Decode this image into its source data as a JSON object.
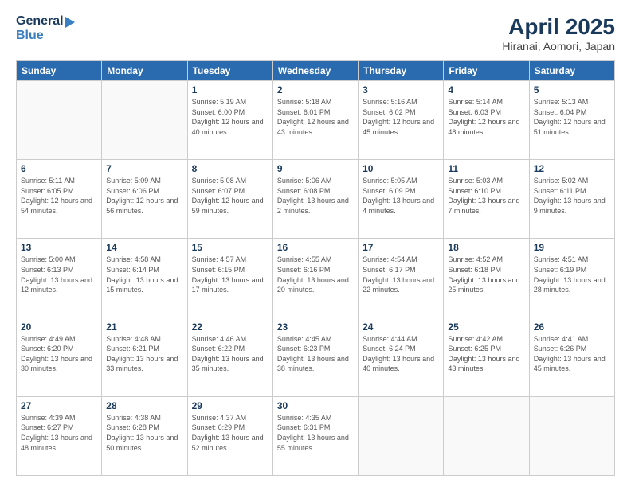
{
  "header": {
    "logo_general": "General",
    "logo_blue": "Blue",
    "title": "April 2025",
    "subtitle": "Hiranai, Aomori, Japan"
  },
  "days_of_week": [
    "Sunday",
    "Monday",
    "Tuesday",
    "Wednesday",
    "Thursday",
    "Friday",
    "Saturday"
  ],
  "weeks": [
    [
      {
        "day": "",
        "info": ""
      },
      {
        "day": "",
        "info": ""
      },
      {
        "day": "1",
        "info": "Sunrise: 5:19 AM\nSunset: 6:00 PM\nDaylight: 12 hours and 40 minutes."
      },
      {
        "day": "2",
        "info": "Sunrise: 5:18 AM\nSunset: 6:01 PM\nDaylight: 12 hours and 43 minutes."
      },
      {
        "day": "3",
        "info": "Sunrise: 5:16 AM\nSunset: 6:02 PM\nDaylight: 12 hours and 45 minutes."
      },
      {
        "day": "4",
        "info": "Sunrise: 5:14 AM\nSunset: 6:03 PM\nDaylight: 12 hours and 48 minutes."
      },
      {
        "day": "5",
        "info": "Sunrise: 5:13 AM\nSunset: 6:04 PM\nDaylight: 12 hours and 51 minutes."
      }
    ],
    [
      {
        "day": "6",
        "info": "Sunrise: 5:11 AM\nSunset: 6:05 PM\nDaylight: 12 hours and 54 minutes."
      },
      {
        "day": "7",
        "info": "Sunrise: 5:09 AM\nSunset: 6:06 PM\nDaylight: 12 hours and 56 minutes."
      },
      {
        "day": "8",
        "info": "Sunrise: 5:08 AM\nSunset: 6:07 PM\nDaylight: 12 hours and 59 minutes."
      },
      {
        "day": "9",
        "info": "Sunrise: 5:06 AM\nSunset: 6:08 PM\nDaylight: 13 hours and 2 minutes."
      },
      {
        "day": "10",
        "info": "Sunrise: 5:05 AM\nSunset: 6:09 PM\nDaylight: 13 hours and 4 minutes."
      },
      {
        "day": "11",
        "info": "Sunrise: 5:03 AM\nSunset: 6:10 PM\nDaylight: 13 hours and 7 minutes."
      },
      {
        "day": "12",
        "info": "Sunrise: 5:02 AM\nSunset: 6:11 PM\nDaylight: 13 hours and 9 minutes."
      }
    ],
    [
      {
        "day": "13",
        "info": "Sunrise: 5:00 AM\nSunset: 6:13 PM\nDaylight: 13 hours and 12 minutes."
      },
      {
        "day": "14",
        "info": "Sunrise: 4:58 AM\nSunset: 6:14 PM\nDaylight: 13 hours and 15 minutes."
      },
      {
        "day": "15",
        "info": "Sunrise: 4:57 AM\nSunset: 6:15 PM\nDaylight: 13 hours and 17 minutes."
      },
      {
        "day": "16",
        "info": "Sunrise: 4:55 AM\nSunset: 6:16 PM\nDaylight: 13 hours and 20 minutes."
      },
      {
        "day": "17",
        "info": "Sunrise: 4:54 AM\nSunset: 6:17 PM\nDaylight: 13 hours and 22 minutes."
      },
      {
        "day": "18",
        "info": "Sunrise: 4:52 AM\nSunset: 6:18 PM\nDaylight: 13 hours and 25 minutes."
      },
      {
        "day": "19",
        "info": "Sunrise: 4:51 AM\nSunset: 6:19 PM\nDaylight: 13 hours and 28 minutes."
      }
    ],
    [
      {
        "day": "20",
        "info": "Sunrise: 4:49 AM\nSunset: 6:20 PM\nDaylight: 13 hours and 30 minutes."
      },
      {
        "day": "21",
        "info": "Sunrise: 4:48 AM\nSunset: 6:21 PM\nDaylight: 13 hours and 33 minutes."
      },
      {
        "day": "22",
        "info": "Sunrise: 4:46 AM\nSunset: 6:22 PM\nDaylight: 13 hours and 35 minutes."
      },
      {
        "day": "23",
        "info": "Sunrise: 4:45 AM\nSunset: 6:23 PM\nDaylight: 13 hours and 38 minutes."
      },
      {
        "day": "24",
        "info": "Sunrise: 4:44 AM\nSunset: 6:24 PM\nDaylight: 13 hours and 40 minutes."
      },
      {
        "day": "25",
        "info": "Sunrise: 4:42 AM\nSunset: 6:25 PM\nDaylight: 13 hours and 43 minutes."
      },
      {
        "day": "26",
        "info": "Sunrise: 4:41 AM\nSunset: 6:26 PM\nDaylight: 13 hours and 45 minutes."
      }
    ],
    [
      {
        "day": "27",
        "info": "Sunrise: 4:39 AM\nSunset: 6:27 PM\nDaylight: 13 hours and 48 minutes."
      },
      {
        "day": "28",
        "info": "Sunrise: 4:38 AM\nSunset: 6:28 PM\nDaylight: 13 hours and 50 minutes."
      },
      {
        "day": "29",
        "info": "Sunrise: 4:37 AM\nSunset: 6:29 PM\nDaylight: 13 hours and 52 minutes."
      },
      {
        "day": "30",
        "info": "Sunrise: 4:35 AM\nSunset: 6:31 PM\nDaylight: 13 hours and 55 minutes."
      },
      {
        "day": "",
        "info": ""
      },
      {
        "day": "",
        "info": ""
      },
      {
        "day": "",
        "info": ""
      }
    ]
  ]
}
